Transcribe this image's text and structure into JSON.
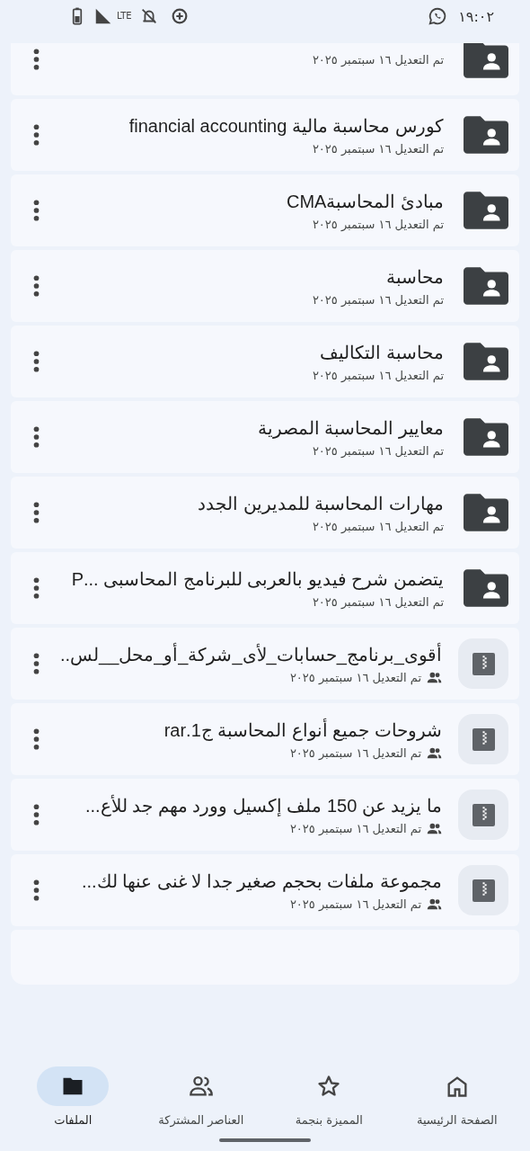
{
  "status_bar": {
    "time": "١٩:٠٢",
    "network": "LTE"
  },
  "files": [
    {
      "kind": "folder",
      "shared": false,
      "modified": "تم التعديل ١٦ سبتمبر ٢٠٢٥"
    },
    {
      "kind": "folder",
      "shared": false,
      "title": "كورس محاسبة مالية financial accounting",
      "modified": "تم التعديل ١٦ سبتمبر ٢٠٢٥"
    },
    {
      "kind": "folder",
      "shared": false,
      "title": "مبادئ المحاسبةCMA",
      "modified": "تم التعديل ١٦ سبتمبر ٢٠٢٥"
    },
    {
      "kind": "folder",
      "shared": false,
      "title": "محاسبة",
      "modified": "تم التعديل ١٦ سبتمبر ٢٠٢٥"
    },
    {
      "kind": "folder",
      "shared": false,
      "title": "محاسبة التكاليف",
      "modified": "تم التعديل ١٦ سبتمبر ٢٠٢٥"
    },
    {
      "kind": "folder",
      "shared": false,
      "title": "معايير المحاسبة المصرية",
      "modified": "تم التعديل ١٦ سبتمبر ٢٠٢٥"
    },
    {
      "kind": "folder",
      "shared": false,
      "title": "مهارات المحاسبة للمديرين الجدد",
      "modified": "تم التعديل ١٦ سبتمبر ٢٠٢٥"
    },
    {
      "kind": "folder",
      "shared": false,
      "title": "يتضمن شرح فيديو بالعربى للبرنامج المحاسبى ...P",
      "modified": "تم التعديل ١٦ سبتمبر ٢٠٢٥"
    },
    {
      "kind": "archive",
      "shared": true,
      "title": "أقوى_برنامج_حسابات_لأى_شركة_أو_محل__لس..",
      "modified": "تم التعديل ١٦ سبتمبر ٢٠٢٥"
    },
    {
      "kind": "archive",
      "shared": true,
      "title": "شروحات جميع أنواع المحاسبة ج1.rar",
      "modified": "تم التعديل ١٦ سبتمبر ٢٠٢٥"
    },
    {
      "kind": "archive",
      "shared": true,
      "title": "ما يزيد عن 150 ملف إكسيل وورد   مهم جد للأع...",
      "modified": "تم التعديل ١٦ سبتمبر ٢٠٢٥"
    },
    {
      "kind": "archive",
      "shared": true,
      "title": "مجموعة ملفات بحجم صغير جدا لا غنى عنها لك...",
      "modified": "تم التعديل ١٦ سبتمبر ٢٠٢٥"
    }
  ],
  "bottom_nav": [
    {
      "kind": "home",
      "label": "الصفحة الرئيسية",
      "selected": false
    },
    {
      "kind": "starred",
      "label": "المميزة بنجمة",
      "selected": false
    },
    {
      "kind": "shared",
      "label": "العناصر المشتركة",
      "selected": false
    },
    {
      "kind": "files",
      "label": "الملفات",
      "selected": true
    }
  ]
}
